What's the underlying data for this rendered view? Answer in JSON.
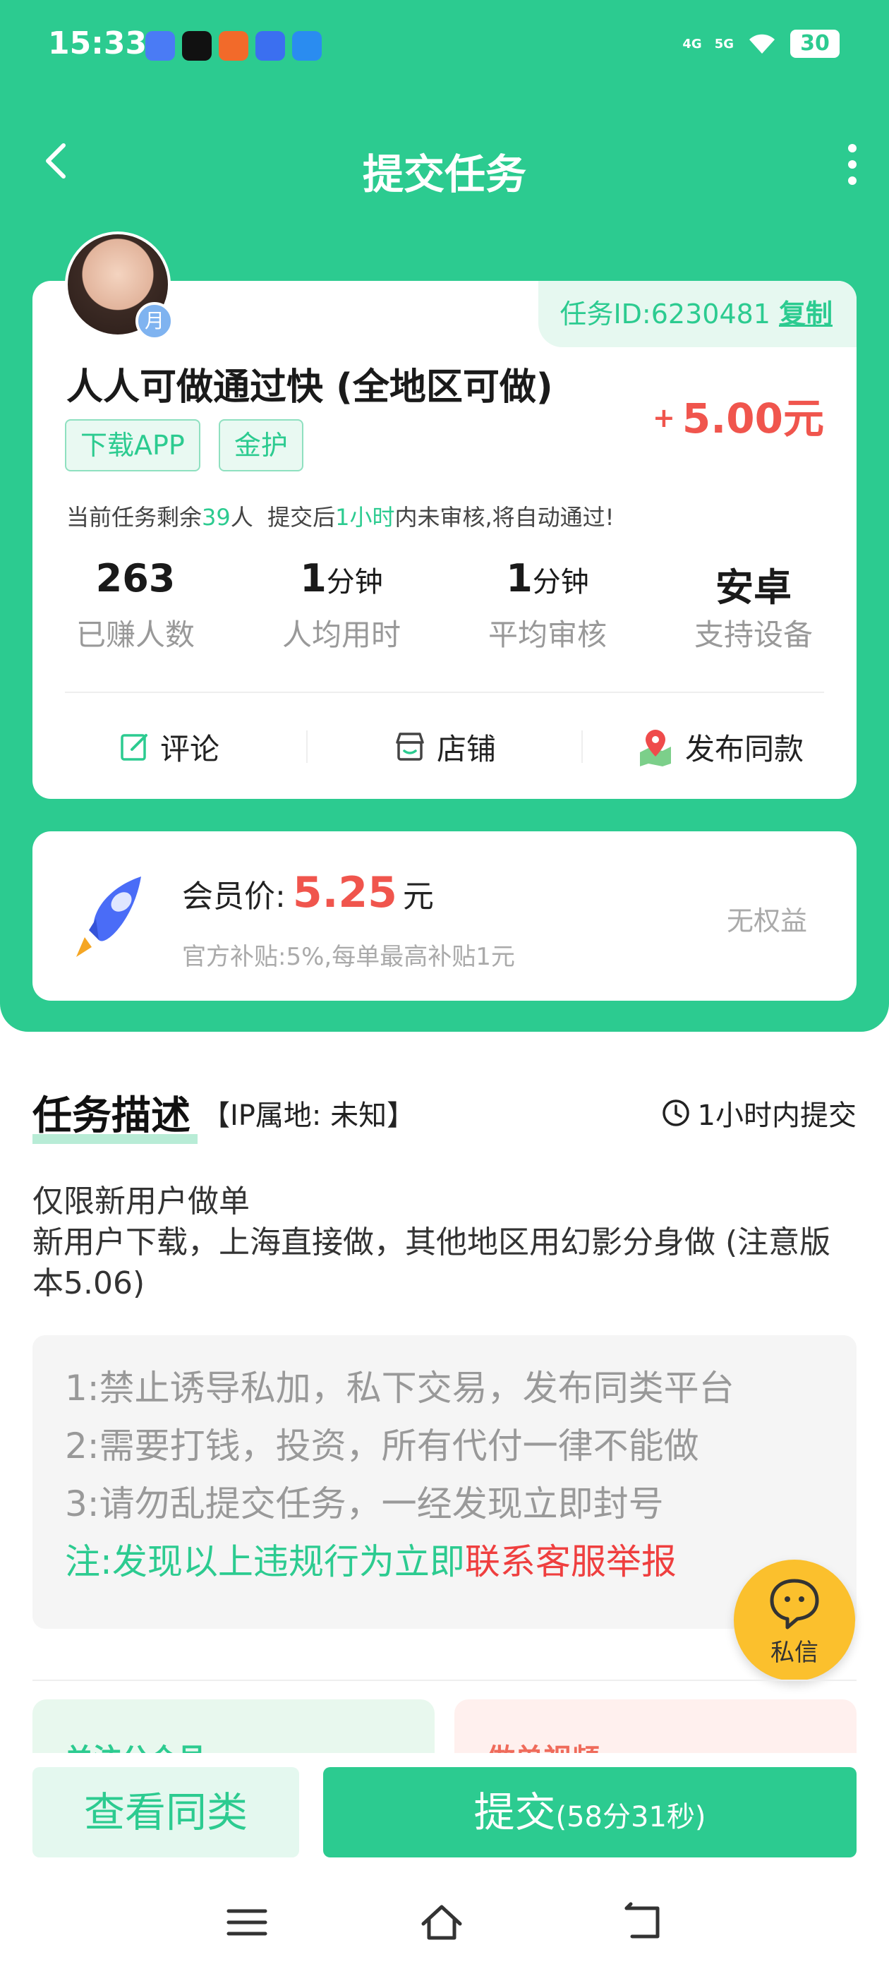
{
  "status_bar": {
    "time": "15:33",
    "battery": "30",
    "signal1": "4G",
    "signal2": "5G"
  },
  "nav": {
    "title": "提交任务"
  },
  "task": {
    "id_label": "任务ID:6230481",
    "copy_label": "复制",
    "title": "人人可做通过快 (全地区可做)",
    "price_sign": "+",
    "price": "5.00元",
    "tags": [
      "下载APP",
      "金护"
    ],
    "remain_prefix": "当前任务剩余",
    "remain_count": "39",
    "remain_mid": "人  提交后",
    "remain_time": "1小时",
    "remain_suffix": "内未审核,将自动通过!",
    "avatar_badge": "月"
  },
  "stats": [
    {
      "value": "263",
      "unit": "",
      "label": "已赚人数"
    },
    {
      "value": "1",
      "unit": "分钟",
      "label": "人均用时"
    },
    {
      "value": "1",
      "unit": "分钟",
      "label": "平均审核"
    },
    {
      "value": "安卓",
      "unit": "",
      "label": "支持设备"
    }
  ],
  "actions": {
    "comment": "评论",
    "shop": "店铺",
    "publish": "发布同款"
  },
  "member": {
    "label": "会员价:",
    "price": "5.25",
    "unit": "元",
    "note": "官方补贴:5%,每单最高补贴1元",
    "status": "无权益"
  },
  "description": {
    "heading": "任务描述",
    "ip": "【IP属地: 未知】",
    "deadline": "1小时内提交",
    "text1": "仅限新用户做单",
    "text2": "新用户下载，上海直接做，其他地区用幻影分身做 (注意版本5.06)"
  },
  "rules": {
    "r1": "1:禁止诱导私加，私下交易，发布同类平台",
    "r2": "2:需要打钱，投资，所有代付一律不能做",
    "r3": "3:请勿乱提交任务，一经发现立即封号",
    "note_green": "注:发现以上违规行为立即",
    "note_red": "联系客服举报"
  },
  "fab": {
    "label": "私信"
  },
  "promo": {
    "left": "关注公众号",
    "right": "做单视频"
  },
  "buttons": {
    "similar": "查看同类",
    "submit": "提交",
    "timer": "(58分31秒)"
  },
  "colors": {
    "primary": "#2ccb90",
    "price": "#f0554d",
    "warning": "#ef3f3f",
    "fab": "#fbc02d"
  }
}
